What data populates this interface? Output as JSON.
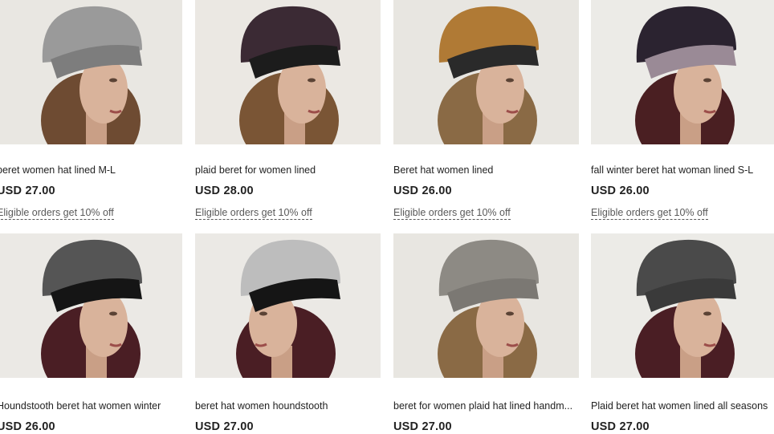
{
  "listings": [
    {
      "title": "beret women hat lined M-L",
      "price": "USD 27.00",
      "promo": "Eligible orders get 10% off",
      "image": "grey-floral-knit-beret-photo",
      "hat_color": "#9a9a9a",
      "band_color": "#7d7d7d",
      "hair_color": "#6e4b32",
      "bg_color": "#e9e7e2"
    },
    {
      "title": "plaid beret for women lined",
      "price": "USD 28.00",
      "promo": "Eligible orders get 10% off",
      "image": "plaid-burgundy-beret-photo",
      "hat_color": "#3b2a34",
      "band_color": "#1c1c1c",
      "hair_color": "#7a5535",
      "bg_color": "#ebe8e3"
    },
    {
      "title": "Beret hat women lined",
      "price": "USD 26.00",
      "promo": "Eligible orders get 10% off",
      "image": "leopard-print-beret-photo",
      "hat_color": "#b07a35",
      "band_color": "#2a2a2a",
      "hair_color": "#8a6a45",
      "bg_color": "#e8e6e1"
    },
    {
      "title": "fall winter beret hat woman lined S-L",
      "price": "USD 26.00",
      "promo": "Eligible orders get 10% off",
      "image": "purple-floral-beret-photo",
      "hat_color": "#2b2330",
      "band_color": "#9a8a96",
      "hair_color": "#4a1f22",
      "bg_color": "#ecebe7"
    },
    {
      "title": "Houndstooth beret hat women winter",
      "price": "USD 26.00",
      "image": "houndstooth-black-beret-photo",
      "hat_color": "#555555",
      "band_color": "#151515",
      "hair_color": "#4a1e24",
      "bg_color": "#ebe9e5"
    },
    {
      "title": "beret hat women houndstooth",
      "price": "USD 27.00",
      "image": "houndstooth-white-beret-photo",
      "hat_color": "#bdbdbd",
      "band_color": "#151515",
      "hair_color": "#4a1e24",
      "bg_color": "#ebe9e5"
    },
    {
      "title": "beret for women plaid hat lined handm...",
      "price": "USD 27.00",
      "image": "grey-plaid-beret-photo",
      "hat_color": "#8d8a84",
      "band_color": "#7b7873",
      "hair_color": "#8a6a45",
      "bg_color": "#e8e6e1"
    },
    {
      "title": "Plaid beret hat women lined all seasons",
      "price": "USD 27.00",
      "image": "black-white-plaid-beret-photo",
      "hat_color": "#4a4a4a",
      "band_color": "#3a3a3a",
      "hair_color": "#4a1e24",
      "bg_color": "#ecebe7"
    }
  ]
}
